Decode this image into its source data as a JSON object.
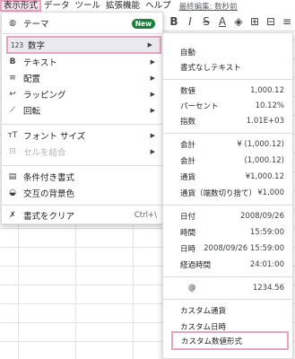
{
  "menubar": {
    "items": [
      "表示形式",
      "データ",
      "ツール",
      "拡張機能",
      "ヘルプ"
    ],
    "last_edit": "最終編集: 数秒前"
  },
  "format_menu": {
    "theme": {
      "icon": "palette-icon",
      "label": "テーマ",
      "badge": "New"
    },
    "number": {
      "icon": "number-format-icon",
      "icon_text": "123",
      "label": "数字"
    },
    "text": {
      "icon": "bold-icon",
      "icon_text": "B",
      "label": "テキスト"
    },
    "alignment": {
      "icon": "align-icon",
      "label": "配置"
    },
    "wrapping": {
      "icon": "wrap-icon",
      "label": "ラッピング"
    },
    "rotation": {
      "icon": "rotate-icon",
      "label": "回転"
    },
    "font_size": {
      "icon": "font-size-icon",
      "icon_text": "тT",
      "label": "フォント サイズ"
    },
    "merge_cells": {
      "icon": "merge-icon",
      "label": "セルを結合",
      "disabled": true
    },
    "conditional": {
      "icon": "conditional-format-icon",
      "label": "条件付き書式"
    },
    "alternating": {
      "icon": "alternating-colors-icon",
      "label": "交互の背景色"
    },
    "clear": {
      "icon": "clear-format-icon",
      "label": "書式をクリア",
      "shortcut": "Ctrl+\\"
    }
  },
  "number_menu": {
    "group1": [
      {
        "label": "自動",
        "value": ""
      },
      {
        "label": "書式なしテキスト",
        "value": ""
      }
    ],
    "group2": [
      {
        "label": "数値",
        "value": "1,000.12"
      },
      {
        "label": "パーセント",
        "value": "10.12%"
      },
      {
        "label": "指数",
        "value": "1.01E+03"
      }
    ],
    "group3": [
      {
        "label": "会計",
        "value": "¥ (1,000.12)"
      },
      {
        "label": "会計",
        "value": "(1,000.12)"
      },
      {
        "label": "通貨",
        "value": "¥1,000.12"
      },
      {
        "label": "通貨（端数切り捨て）",
        "value": "¥1,000"
      }
    ],
    "group4": [
      {
        "label": "日付",
        "value": "2008/09/26"
      },
      {
        "label": "時間",
        "value": "15:59:00"
      },
      {
        "label": "日時",
        "value": "2008/09/26 15:59:00"
      },
      {
        "label": "経過時間",
        "value": "24:01:00"
      }
    ],
    "group5": [
      {
        "label": "@",
        "value": "1234.56"
      }
    ],
    "group6": [
      {
        "label": "カスタム通貨",
        "value": ""
      },
      {
        "label": "カスタム日時",
        "value": ""
      },
      {
        "label": "カスタム数値形式",
        "value": ""
      }
    ]
  },
  "colors": {
    "highlight_border": "#e8a3bd",
    "badge_green": "#188038",
    "grid_line": "#e2e3e3"
  }
}
